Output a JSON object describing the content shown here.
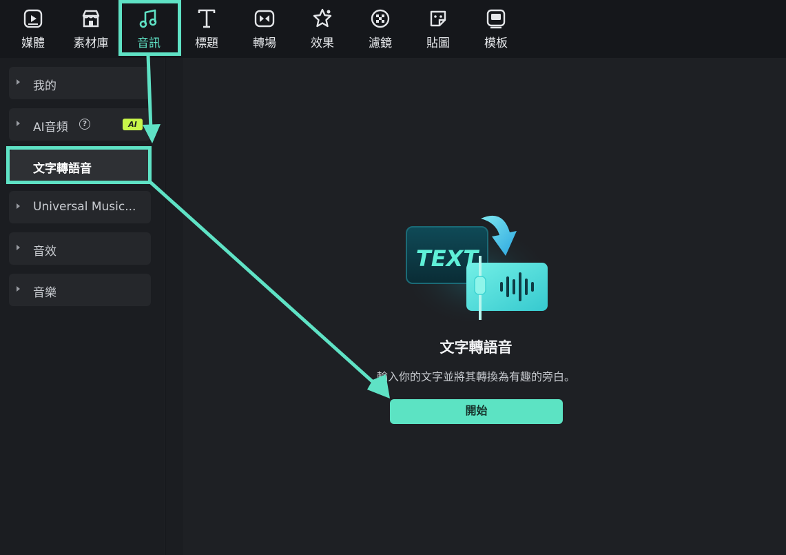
{
  "toolbar": {
    "tabs": [
      {
        "label": "媒體",
        "icon": "media-icon"
      },
      {
        "label": "素材庫",
        "icon": "store-icon"
      },
      {
        "label": "音訊",
        "icon": "music-note-icon",
        "active": true
      },
      {
        "label": "標題",
        "icon": "text-t-icon"
      },
      {
        "label": "轉場",
        "icon": "transition-icon"
      },
      {
        "label": "效果",
        "icon": "effects-star-icon"
      },
      {
        "label": "濾鏡",
        "icon": "filter-icon"
      },
      {
        "label": "貼圖",
        "icon": "sticker-icon"
      },
      {
        "label": "模板",
        "icon": "template-icon"
      }
    ]
  },
  "sidebar": {
    "items": [
      {
        "label": "我的"
      },
      {
        "label": "AI音頻",
        "badge": "AI"
      },
      {
        "label": "文字轉語音",
        "selected": true
      },
      {
        "label": "Universal Music..."
      },
      {
        "label": "音效"
      },
      {
        "label": "音樂"
      }
    ]
  },
  "main": {
    "illustration": {
      "text": "TEXT"
    },
    "title": "文字轉語音",
    "description": "輸入你的文字並將其轉換為有趣的旁白。",
    "start_button": "開始"
  },
  "colors": {
    "accent": "#5ce3c3",
    "annotation": "#5fe2c5",
    "ai_badge": "#c8f54a",
    "background": "#15171b"
  }
}
